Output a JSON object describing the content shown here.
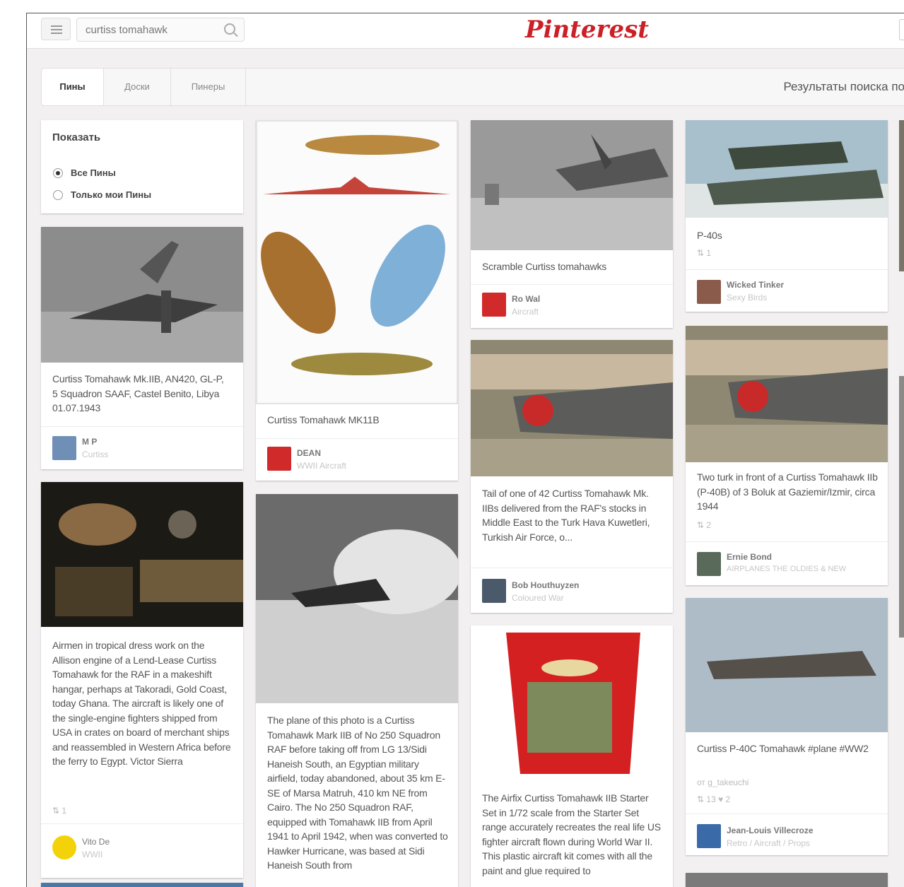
{
  "header": {
    "search_value": "curtiss tomahawk",
    "logo": "Pinterest"
  },
  "tabs": [
    {
      "label": "Пины",
      "active": true
    },
    {
      "label": "Доски",
      "active": false
    },
    {
      "label": "Пинеры",
      "active": false
    }
  ],
  "results_text": "Результаты поиска по",
  "filter": {
    "title": "Показать",
    "options": [
      {
        "label": "Все Пины",
        "selected": true
      },
      {
        "label": "Только мои Пины",
        "selected": false
      }
    ]
  },
  "pins": [
    {
      "desc": "Curtiss Tomahawk Mk.IIB, AN420, GL-P, 5 Squadron SAAF, Castel Benito, Libya 01.07.1943",
      "user": "M P",
      "board": "Curtiss"
    },
    {
      "desc": "Airmen in tropical dress work on the Allison engine of a Lend-Lease Curtiss Tomahawk for the RAF in a makeshift hangar, perhaps at Takoradi, Gold Coast, today Ghana. The aircraft is likely one of the single-engine fighters shipped from USA in crates on board of merchant ships and reassembled in Western Africa before the ferry to Egypt. Victor Sierra",
      "stats": "⇅ 1",
      "user": "Vito De",
      "board": "WWII"
    },
    {
      "desc": "Curtiss Tomahawk MK11B",
      "user": "DEAN",
      "board": "WWII Aircraft"
    },
    {
      "desc": "The plane of this photo is a Curtiss Tomahawk Mark IIB of No 250 Squadron RAF before taking off from LG 13/Sidi Haneish South, an Egyptian military airfield, today abandoned, about 35 km E-SE of Marsa Matruh, 410 km NE from Cairo. The No 250 Squadron RAF, equipped with Tomahawk IIB from April 1941 to April 1942, when was converted to Hawker Hurricane, was based at Sidi Haneish South from"
    },
    {
      "desc": "Scramble Curtiss tomahawks",
      "user": "Ro Wal",
      "board": "Aircraft"
    },
    {
      "desc": "Tail of one of 42 Curtiss Tomahawk Mk. IIBs delivered from the RAF's stocks in Middle East to the Turk Hava Kuwetleri, Turkish Air Force, o...",
      "user": "Bob Houthuyzen",
      "board": "Coloured War"
    },
    {
      "desc": "The Airfix Curtiss Tomahawk IIB Starter Set in 1/72 scale from the Starter Set range accurately recreates the real life US fighter aircraft flown during World War II. This plastic aircraft kit comes with all the paint and glue required to"
    },
    {
      "desc": "P-40s",
      "stats": "⇅ 1",
      "user": "Wicked Tinker",
      "board": "Sexy Birds"
    },
    {
      "desc": "Two turk in front of a Curtiss Tomahawk IIb (P-40B) of 3 Boluk at Gaziemir/Izmir, circa 1944",
      "stats": "⇅ 2",
      "user": "Ernie Bond",
      "board": "AIRPLANES THE OLDIES & NEW"
    },
    {
      "desc": "Curtiss P-40C Tomahawk #plane #WW2",
      "via": "от g_takeuchi",
      "stats": "⇅ 13  ♥ 2",
      "user": "Jean-Louis Villecroze",
      "board": "Retro / Aircraft / Props"
    }
  ],
  "colors": {
    "brand": "#cb2027",
    "background": "#f2f0f0"
  }
}
